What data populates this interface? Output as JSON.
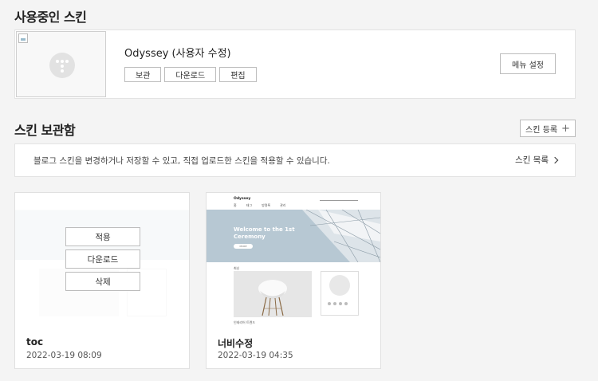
{
  "current_section": {
    "title": "사용중인 스킨",
    "skin_name": "Odyssey (사용자 수정)",
    "actions": [
      "보관",
      "다운로드",
      "편집"
    ],
    "menu_button": "메뉴 설정"
  },
  "storage_section": {
    "title": "스킨 보관함",
    "register_button": "스킨 등록",
    "notice": "블로그 스킨을 변경하거나 저장할 수 있고, 직접 업로드한 스킨을 적용할 수 있습니다.",
    "list_link": "스킨 목록"
  },
  "cards": [
    {
      "name": "toc",
      "date": "2022-03-19 08:09",
      "overlay_buttons": [
        "적용",
        "다운로드",
        "삭제"
      ]
    },
    {
      "name": "너비수정",
      "date": "2022-03-19 04:35",
      "preview": {
        "logo": "Odyssey",
        "nav": [
          "홈",
          "태그",
          "방명록",
          "관리"
        ],
        "hero_line1": "Welcome to the 1st",
        "hero_line2": "Ceremony",
        "hero_button": "MORE",
        "section_label": "최신",
        "caption": "인테리어 트렌드"
      }
    }
  ],
  "colors": {
    "background": "#f4f4f4",
    "hero": "#b7c8d3"
  }
}
